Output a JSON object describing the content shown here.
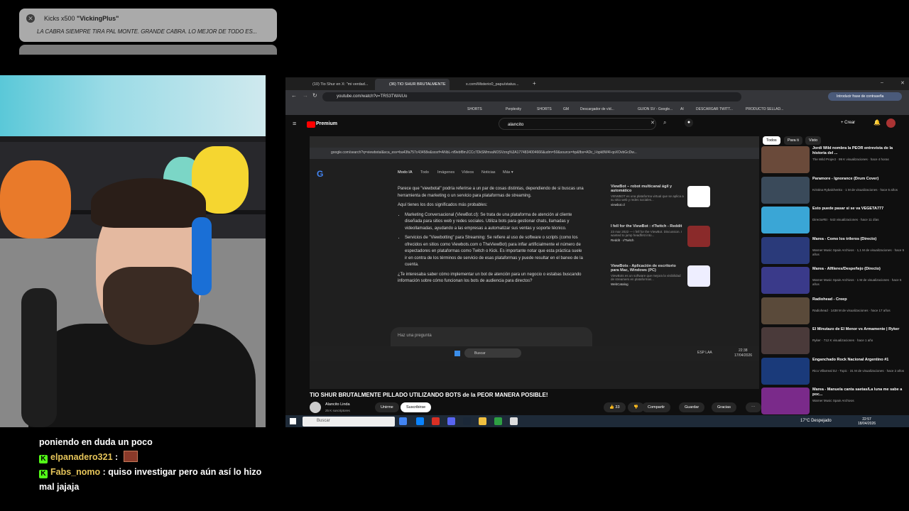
{
  "alert": {
    "title_prefix": "Kicks x500",
    "title_user": "\"VickingPlus\"",
    "message": "LA CABRA SIEMPRE TIRA PAL MONTE. GRANDE CABRA. LO MEJOR DE TODO ES..."
  },
  "browser": {
    "tabs": [
      "(10) Tio Shur en X: \"mi verdad...",
      "(36) TIO SHUR BRUTALMENTE",
      "x.com/Misterio0_papu/status..."
    ],
    "url": "youtube.com/watch?v=TRS3TWAIUo",
    "profile_text": "Introducir frase de contraseña",
    "bookmarks": [
      "SHORTS",
      "Perplexity",
      "SHORTS",
      "GM",
      "Descargador de víd...",
      "GUION SV - Google...",
      "AI",
      "DESCARGAR TWITT...",
      "PRODUCTO SELLAD..."
    ]
  },
  "youtube": {
    "brand": "Premium",
    "search_value": "alancito",
    "create_label": "Crear",
    "video_title": "TIO SHUR BRUTALMENTE PILLADO UTILIZANDO BOTS de la PEOR MANERA POSIBLE!",
    "channel_name": "Alancito Linda",
    "channel_subs": "25 K suscriptores",
    "join_label": "Unirme",
    "subscribe_label": "Suscribirse",
    "likes": "33",
    "share_label": "Compartir",
    "save_label": "Guardar",
    "thanks_label": "Gracias",
    "chips": [
      "Todos",
      "Para ti",
      "Visto"
    ],
    "recommendations": [
      {
        "title": "Jordi Wild nombra la PEOR entrevista de la historia del ...",
        "meta": "The Wild Project · 99 K visualizaciones · hace 4 horas",
        "color": "#6a4a3a"
      },
      {
        "title": "Paramore - Ignorance (Drum Cover)",
        "meta": "Kristina Rybalchenko · 1 M de visualizaciones · hace 5 años",
        "color": "#3a4a5a"
      },
      {
        "title": "Esto puede pasar si se va VEGETA777",
        "meta": "Directo#EI · 543 visualizaciones · hace 11 días",
        "color": "#3aa6d6"
      },
      {
        "title": "Marea - Como los trileros (Directo)",
        "meta": "Warner Music Spain Archivos · 1,1 M de visualizaciones · hace 5 años",
        "color": "#2a3a7a"
      },
      {
        "title": "Marea - Alfileres/Despeñejo (Directo)",
        "meta": "Warner Music Spain Archivos · 1 M de visualizaciones · hace 5 años",
        "color": "#3a3a8a"
      },
      {
        "title": "Radiohead - Creep",
        "meta": "Radiohead · 1438 M de visualizaciones · hace 17 años",
        "color": "#5a4a3a"
      },
      {
        "title": "El Minutazo de El Menor vs Armamente | Ryker",
        "meta": "Ryker · 712 K visualizaciones · hace 1 año",
        "color": "#4a3a3a"
      },
      {
        "title": "Enganchado Rock Nacional Argentino #1",
        "meta": "Rico Villarreal DJ - Topic · 31 M de visualizaciones · hace 2 años",
        "color": "#1a3a7a"
      },
      {
        "title": "Marea - Manuela canta saetas/La luna me sabe a poc...",
        "meta": "Warner Music Spain Archivos",
        "color": "#7a2a8a"
      }
    ]
  },
  "inner": {
    "url": "google.com/search?q=viewbotal&sca_esv=ba43fa757c43458e&sxsrf=ANbL-nf9ebf8mJCCc7DkSMmvaNOSVzng%3A1774834004666&udm=50&source=hp&fbs=ADc_l-bpk8W4l-qoXOvbGcDw...",
    "google_logo": "G",
    "nav": [
      "Modo IA",
      "Todo",
      "Imágenes",
      "Vídeos",
      "Noticias",
      "Más ▾"
    ],
    "intro": "Parece que \"viewbotal\" podría referirse a un par de cosas distintas, dependiendo de si buscas una herramienta de marketing o un servicio para plataformas de streaming.",
    "meanings_title": "Aquí tienes los dos significados más probables:",
    "bullet1": "Marketing Conversacional (ViewBot.cl): Se trata de una plataforma de atención al cliente diseñada para sitios web y redes sociales. Utiliza bots para gestionar chats, llamadas y videollamadas, ayudando a las empresas a automatizar sus ventas y soporte técnico.",
    "bullet2": "Servicios de \"Viewbotting\" para Streaming: Se refiere al uso de software o scripts (como los ofrecidos en sitios como Viewbots.com o TheViewBot) para inflar artificialmente el número de espectadores en plataformas como Twitch o Kick. Es importante notar que esta práctica suele ir en contra de los términos de servicio de esas plataformas y puede resultar en el baneo de la cuenta.",
    "question": "¿Te interesaba saber cómo implementar un bot de atención para un negocio o estabas buscando información sobre cómo funcionan los bots de audiencia para directos?",
    "ask_placeholder": "Haz una pregunta",
    "cards": [
      {
        "title": "ViewBot – robot multicanal ágil y automático",
        "desc": "VIEWBOT es una plataforma virtual que se aplica a su sitio web y redes sociales...",
        "src": "viewbot.cl"
      },
      {
        "title": "I fell for the ViewBot : r/Twitch - Reddit",
        "desc": "23 mar 2022 — I fell for the ViewBot. Discussion. I wanted to jump headfirst into...",
        "src": "Reddit · r/Twitch"
      },
      {
        "title": "ViewBots - Aplicación de escritorio para Mac, Windows (PC)",
        "desc": "ViewBots es un software que mejora la visibilidad de streamers en plataformas...",
        "src": "WebCatalog"
      }
    ],
    "taskbar_search": "Buscar",
    "lang": "ESP LAA",
    "time": "22:38",
    "date": "17/04/2026"
  },
  "outer_taskbar": {
    "search": "Buscar",
    "weather": "17°C Despejado",
    "time": "22:57",
    "date": "18/04/2026"
  },
  "chat": {
    "line1": "poniendo en duda un poco",
    "user1": "elpanadero321",
    "user2": "Fabs_nomo",
    "msg2": "quiso investigar pero aún así lo hizo mal jajaja"
  }
}
